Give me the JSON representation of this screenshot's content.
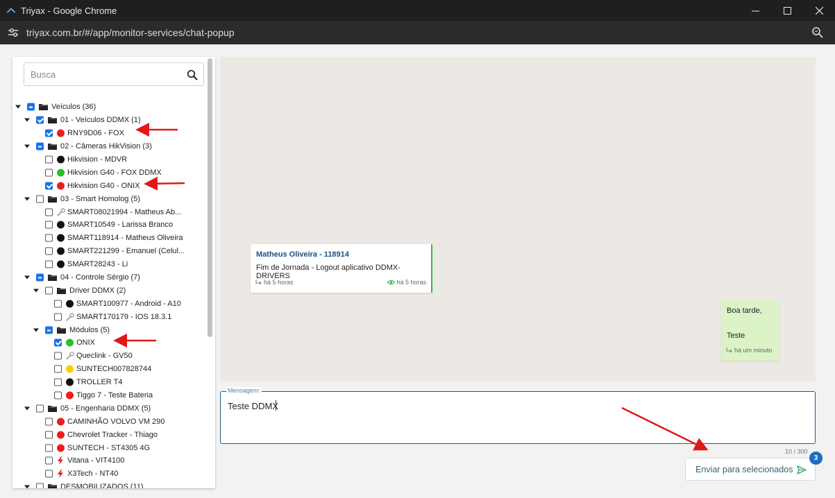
{
  "window": {
    "title": "Triyax - Google Chrome",
    "url": "triyax.com.br/#/app/monitor-services/chat-popup"
  },
  "search": {
    "placeholder": "Busca"
  },
  "tree": [
    {
      "level": 0,
      "caret": true,
      "check": "partial",
      "icon": "folder",
      "label": "Veículos (36)"
    },
    {
      "level": 1,
      "caret": true,
      "check": "checked",
      "icon": "folder",
      "label": "01 - Veículos DDMX (1)"
    },
    {
      "level": 2,
      "caret": false,
      "check": "checked",
      "icon": "red",
      "label": "RNY9D06 - FOX"
    },
    {
      "level": 1,
      "caret": true,
      "check": "partial",
      "icon": "folder",
      "label": "02 - Câmeras HikVision (3)"
    },
    {
      "level": 2,
      "caret": false,
      "check": "none",
      "icon": "black",
      "label": "Hikvision - MDVR"
    },
    {
      "level": 2,
      "caret": false,
      "check": "none",
      "icon": "green",
      "label": "Hikvision G40 - FOX DDMX"
    },
    {
      "level": 2,
      "caret": false,
      "check": "checked",
      "icon": "red",
      "label": "Hikvision G40 - ONIX"
    },
    {
      "level": 1,
      "caret": true,
      "check": "none",
      "icon": "folder",
      "label": "03 - Smart Homolog (5)"
    },
    {
      "level": 2,
      "caret": false,
      "check": "none",
      "icon": "wrench",
      "label": "SMART08021994 - Matheus Ab..."
    },
    {
      "level": 2,
      "caret": false,
      "check": "none",
      "icon": "black",
      "label": "SMART10549 - Larissa Branco"
    },
    {
      "level": 2,
      "caret": false,
      "check": "none",
      "icon": "black",
      "label": "SMART118914 - Matheus Oliveira"
    },
    {
      "level": 2,
      "caret": false,
      "check": "none",
      "icon": "black",
      "label": "SMART221299 - Emanuel (Celul..."
    },
    {
      "level": 2,
      "caret": false,
      "check": "none",
      "icon": "black",
      "label": "SMART28243 - Li"
    },
    {
      "level": 1,
      "caret": true,
      "check": "partial",
      "icon": "folder",
      "label": "04 - Controle Sérgio (7)"
    },
    {
      "level": 2,
      "caret": true,
      "check": "none",
      "icon": "folder",
      "label": "Driver DDMX (2)"
    },
    {
      "level": 3,
      "caret": false,
      "check": "none",
      "icon": "black",
      "label": "SMART100977 - Android - A10"
    },
    {
      "level": 3,
      "caret": false,
      "check": "none",
      "icon": "wrench",
      "label": "SMART170179 - IOS 18.3.1"
    },
    {
      "level": 2,
      "caret": true,
      "check": "partial",
      "icon": "folder",
      "label": "Módulos (5)"
    },
    {
      "level": 3,
      "caret": false,
      "check": "checked",
      "icon": "green",
      "label": "ONIX"
    },
    {
      "level": 3,
      "caret": false,
      "check": "none",
      "icon": "wrench",
      "label": "Queclink - GV50"
    },
    {
      "level": 3,
      "caret": false,
      "check": "none",
      "icon": "yellow",
      "label": "SUNTECH007828744"
    },
    {
      "level": 3,
      "caret": false,
      "check": "none",
      "icon": "black",
      "label": "TROLLER T4"
    },
    {
      "level": 3,
      "caret": false,
      "check": "none",
      "icon": "red",
      "label": "Tiggo 7 - Teste Bateria"
    },
    {
      "level": 1,
      "caret": true,
      "check": "none",
      "icon": "folder",
      "label": "05 - Engenharia DDMX (5)"
    },
    {
      "level": 2,
      "caret": false,
      "check": "none",
      "icon": "red",
      "label": "CAMINHÃO VOLVO VM 290"
    },
    {
      "level": 2,
      "caret": false,
      "check": "none",
      "icon": "red",
      "label": "Chevrolet Tracker - Thiago"
    },
    {
      "level": 2,
      "caret": false,
      "check": "none",
      "icon": "red",
      "label": "SUNTECH - ST4305 4G"
    },
    {
      "level": 2,
      "caret": false,
      "check": "none",
      "icon": "bolt",
      "label": "Vitana - VIT4100"
    },
    {
      "level": 2,
      "caret": false,
      "check": "none",
      "icon": "bolt",
      "label": "X3Tech - NT40"
    },
    {
      "level": 1,
      "caret": true,
      "check": "none",
      "icon": "folder",
      "label": "DESMOBILIZADOS (11)"
    }
  ],
  "messages": {
    "received": {
      "author": "Matheus Oliveira - 118914",
      "text": "Fim de Jornada - Logout aplicativo DDMX-DRIVERS",
      "time_sent": "há 5 horas",
      "time_seen": "há 5 horas"
    },
    "sent": {
      "line1": "Boa tarde,",
      "line2": "Teste",
      "time": "há um minuto"
    }
  },
  "composer": {
    "legend": "Mensagem:",
    "value": "Teste DDMX",
    "counter": "10 / 300"
  },
  "send": {
    "label": "Enviar para selecionados",
    "badge": "3"
  },
  "colors": {
    "accent": "#1a73e8",
    "status_red": "#ee1c1c",
    "status_green": "#22c322",
    "status_yellow": "#ffcc00",
    "sent_bubble": "#dcf3c8",
    "chat_bg": "#ece9e4",
    "annotation_arrow": "#e01818"
  }
}
